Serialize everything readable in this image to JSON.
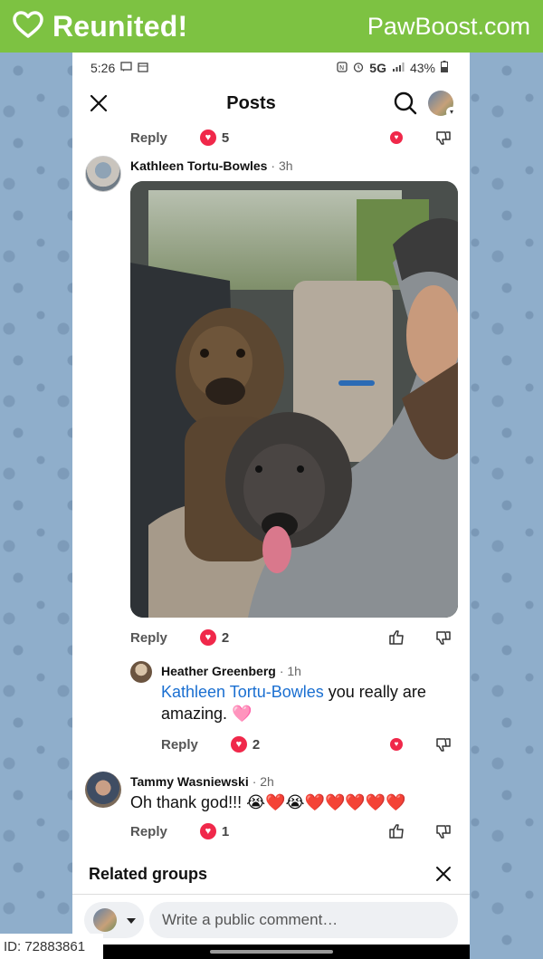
{
  "banner": {
    "title": "Reunited!",
    "brand": "PawBoost.com",
    "color": "#7dc242"
  },
  "status_bar": {
    "time": "5:26",
    "network": "5G",
    "battery": "43%"
  },
  "header": {
    "title": "Posts"
  },
  "top_reply": {
    "reply_label": "Reply",
    "reaction_count": "5"
  },
  "comments": [
    {
      "author": "Kathleen Tortu-Bowles",
      "time": "· 3h",
      "reply_label": "Reply",
      "reaction_count": "2"
    },
    {
      "author": "Heather Greenberg",
      "time": "· 1h",
      "mention": "Kathleen Tortu-Bowles",
      "text": " you really are amazing. 🩷",
      "reply_label": "Reply",
      "reaction_count": "2"
    },
    {
      "author": "Tammy Wasniewski",
      "time": "· 2h",
      "text": "Oh thank god!!! 😭❤️😭❤️❤️❤️❤️❤️",
      "reply_label": "Reply",
      "reaction_count": "1"
    }
  ],
  "related": {
    "title": "Related groups"
  },
  "composer": {
    "placeholder": "Write a public comment…"
  },
  "footer": {
    "id_label": "ID: 72883861"
  },
  "icons": [
    "heart-outline-icon",
    "close-icon",
    "search-icon",
    "heart-icon",
    "thumb-up-icon",
    "thumb-down-icon",
    "chevron-down-icon"
  ]
}
